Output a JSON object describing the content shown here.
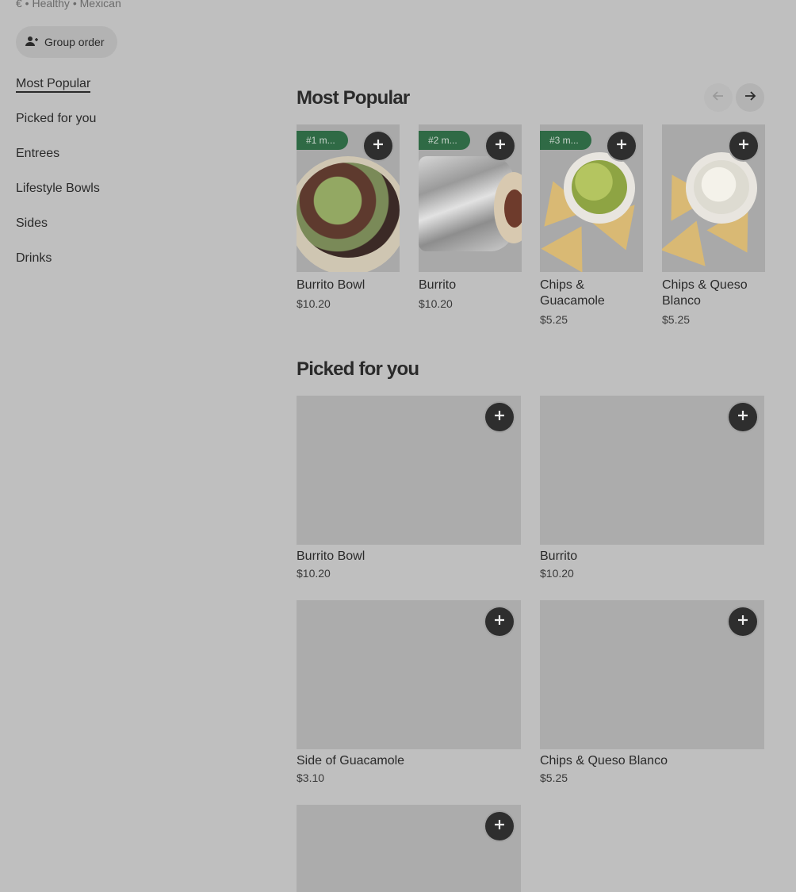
{
  "store": {
    "meta_line": "€ • Healthy • Mexican",
    "group_order_label": "Group order"
  },
  "sidebar": {
    "items": [
      {
        "label": "Most Popular",
        "active": true
      },
      {
        "label": "Picked for you"
      },
      {
        "label": "Entrees"
      },
      {
        "label": "Lifestyle Bowls"
      },
      {
        "label": "Sides"
      },
      {
        "label": "Drinks"
      }
    ]
  },
  "most_popular": {
    "title": "Most Popular",
    "items": [
      {
        "badge": "#1 m...",
        "name": "Burrito Bowl",
        "price": "$10.20",
        "image": "burrito-bowl"
      },
      {
        "badge": "#2 m...",
        "name": "Burrito",
        "price": "$10.20",
        "image": "burrito"
      },
      {
        "badge": "#3 m...",
        "name": "Chips & Guacamole",
        "price": "$5.25",
        "image": "chips-guacamole"
      },
      {
        "name": "Chips & Queso Blanco",
        "price": "$5.25",
        "image": "chips-queso"
      }
    ]
  },
  "picked_for_you": {
    "title": "Picked for you",
    "items": [
      {
        "name": "Burrito Bowl",
        "price": "$10.20"
      },
      {
        "name": "Burrito",
        "price": "$10.20"
      },
      {
        "name": "Side of Guacamole",
        "price": "$3.10"
      },
      {
        "name": "Chips & Queso Blanco",
        "price": "$5.25"
      },
      {
        "name": "",
        "price": ""
      }
    ]
  },
  "colors": {
    "overlay_bg": "#bfbfbf",
    "badge_green": "#2f6a45",
    "add_button": "#2e2e2e"
  },
  "icons": [
    "person-plus-icon",
    "arrow-left-icon",
    "arrow-right-icon",
    "plus-icon"
  ]
}
